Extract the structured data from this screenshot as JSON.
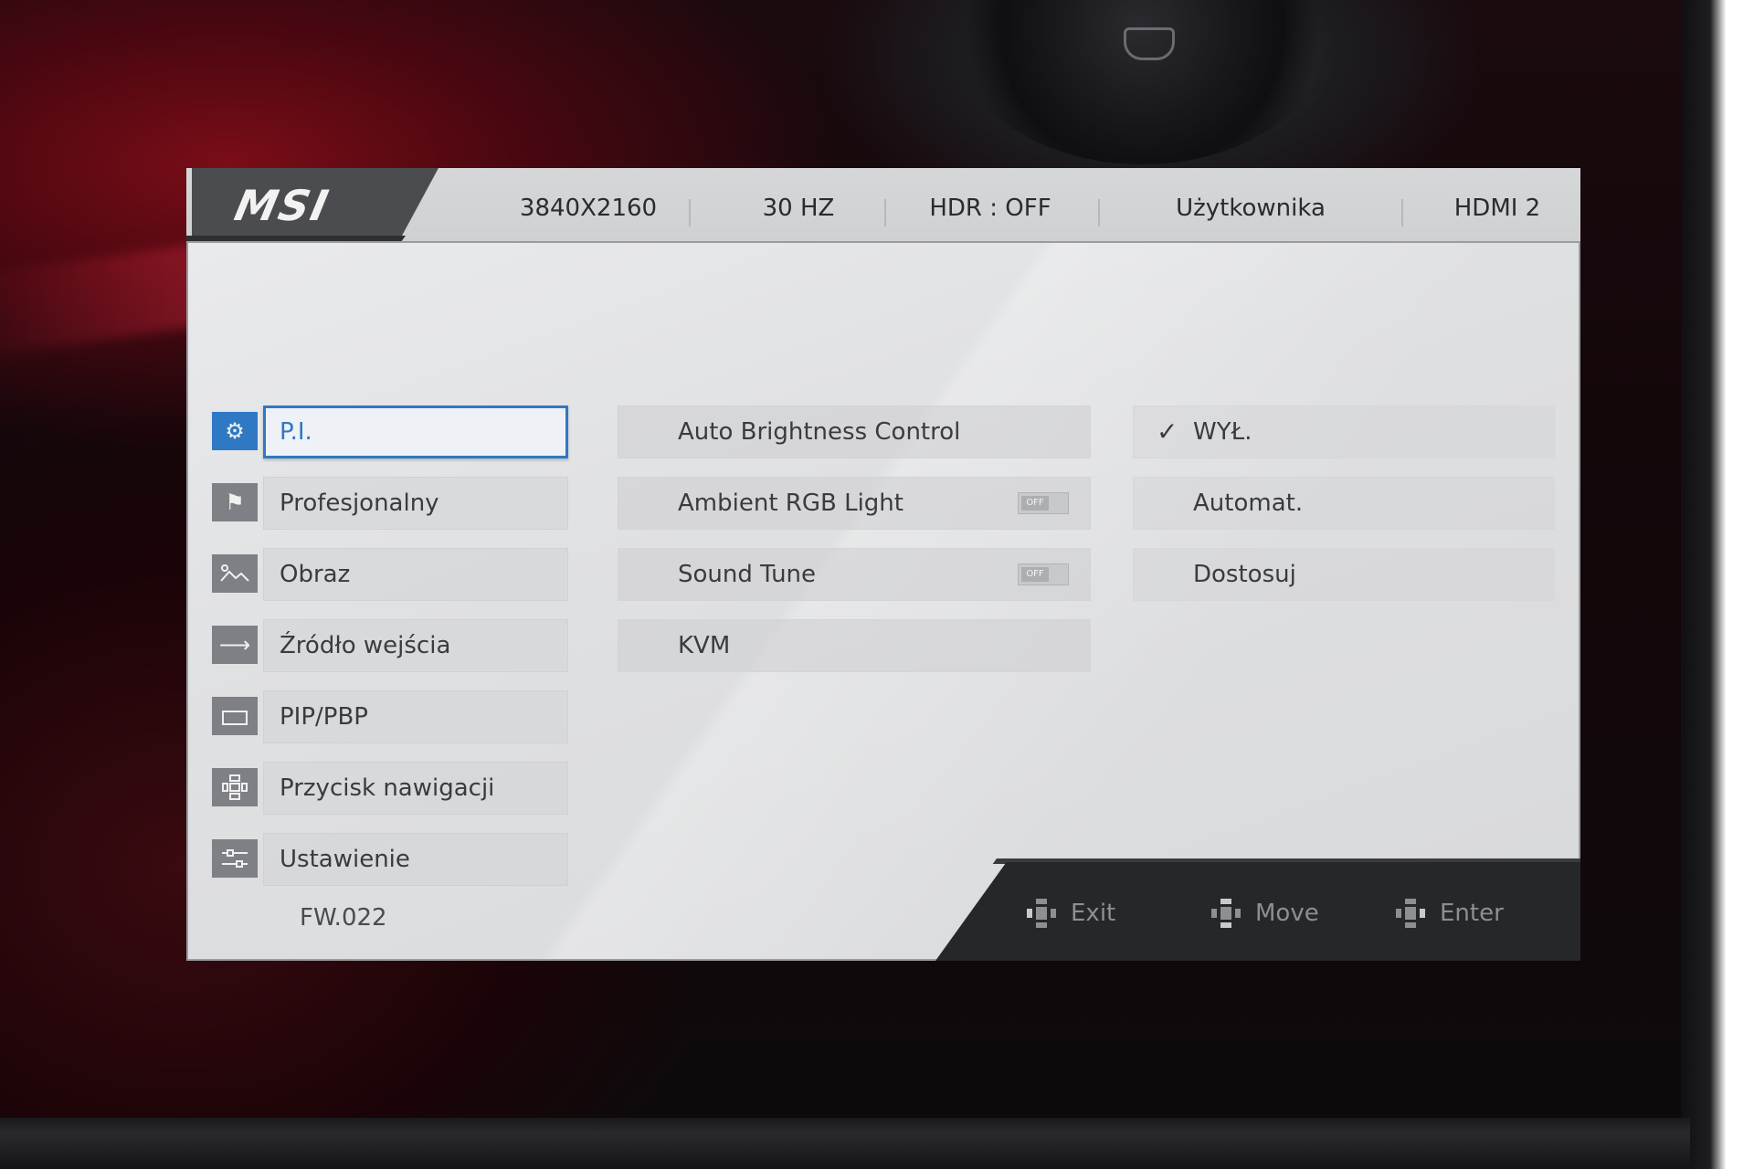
{
  "header": {
    "brand": "MSI",
    "resolution": "3840X2160",
    "refresh": "30 HZ",
    "hdr": "HDR : OFF",
    "profile": "Użytkownika",
    "input": "HDMI 2"
  },
  "menu": {
    "items": [
      {
        "label": "P.I.",
        "icon": "gears-icon",
        "selected": true
      },
      {
        "label": "Profesjonalny",
        "icon": "flag-icon"
      },
      {
        "label": "Obraz",
        "icon": "image-icon"
      },
      {
        "label": "Źródło wejścia",
        "icon": "arrow-right-icon"
      },
      {
        "label": "PIP/PBP",
        "icon": "window-icon"
      },
      {
        "label": "Przycisk nawigacji",
        "icon": "navigation-icon"
      },
      {
        "label": "Ustawienie",
        "icon": "sliders-icon"
      }
    ]
  },
  "options": {
    "items": [
      {
        "label": "Auto Brightness Control"
      },
      {
        "label": "Ambient RGB Light",
        "toggle": "OFF"
      },
      {
        "label": "Sound Tune",
        "toggle": "OFF"
      },
      {
        "label": "KVM"
      }
    ]
  },
  "values": {
    "items": [
      {
        "label": "WYŁ.",
        "checked": true
      },
      {
        "label": "Automat."
      },
      {
        "label": "Dostosuj"
      }
    ]
  },
  "footer": {
    "firmware": "FW.022",
    "exit": "Exit",
    "move": "Move",
    "enter": "Enter"
  },
  "colors": {
    "accent": "#2f78c4",
    "panel": "#e2e3e5",
    "header_tab": "#4b4c50",
    "footer_bar": "#26272a"
  }
}
